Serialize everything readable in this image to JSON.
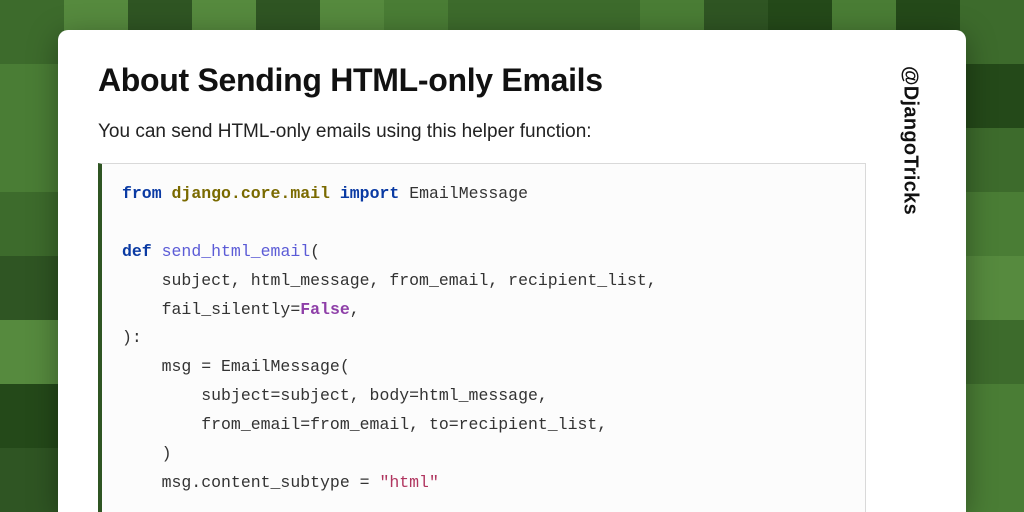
{
  "title": "About Sending HTML-only Emails",
  "intro": "You can send HTML-only emails using this helper function:",
  "handle": "@DjangoTricks",
  "code": {
    "kw_from": "from",
    "module": "django.core.mail",
    "kw_import": "import",
    "import_name": "EmailMessage",
    "kw_def": "def",
    "fn_name": "send_html_email",
    "param_line1": "    subject, html_message, from_email, recipient_list,",
    "param_line2_pre": "    fail_silently=",
    "false_kw": "False",
    "param_line2_post": ",",
    "close_sig": "):",
    "body1": "    msg = EmailMessage(",
    "body2": "        subject=subject, body=html_message,",
    "body3": "        from_email=from_email, to=recipient_list,",
    "body4": "    )",
    "body5_pre": "    msg.content_subtype = ",
    "body5_str": "\"html\""
  }
}
